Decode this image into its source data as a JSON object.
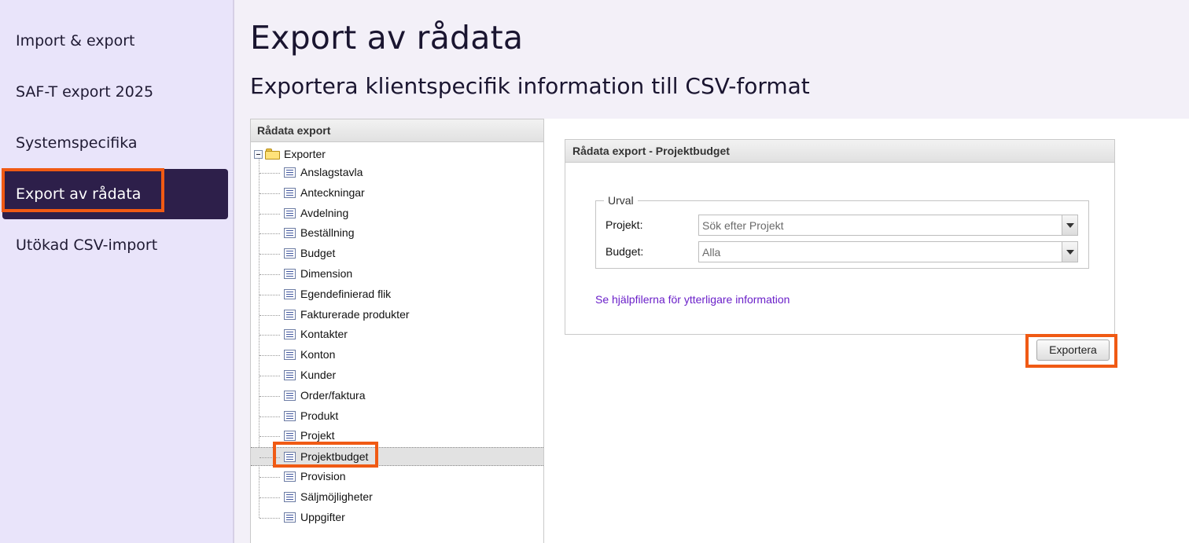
{
  "left_nav": {
    "items": [
      {
        "label": "Import & export",
        "active": false
      },
      {
        "label": "SAF-T export 2025",
        "active": false
      },
      {
        "label": "Systemspecifika",
        "active": false
      },
      {
        "label": "Export av rådata",
        "active": true
      },
      {
        "label": "Utökad CSV-import",
        "active": false
      }
    ]
  },
  "header": {
    "title": "Export av rådata",
    "subtitle": "Exportera klientspecifik information till CSV-format"
  },
  "tree": {
    "header": "Rådata export",
    "root_label": "Exporter",
    "root_icon": "folder-icon",
    "items": [
      "Anslagstavla",
      "Anteckningar",
      "Avdelning",
      "Beställning",
      "Budget",
      "Dimension",
      "Egendefinierad flik",
      "Fakturerade produkter",
      "Kontakter",
      "Konton",
      "Kunder",
      "Order/faktura",
      "Produkt",
      "Projekt",
      "Projektbudget",
      "Provision",
      "Säljmöjligheter",
      "Uppgifter"
    ],
    "selected": "Projektbudget"
  },
  "panel": {
    "header": "Rådata export - Projektbudget",
    "fieldset_legend": "Urval",
    "fields": [
      {
        "label": "Projekt:",
        "value": "Sök efter Projekt"
      },
      {
        "label": "Budget:",
        "value": "Alla"
      }
    ],
    "help_link": "Se hjälpfilerna för ytterligare information"
  },
  "actions": {
    "export_label": "Exportera"
  },
  "colors": {
    "nav_bg": "#e9e4fa",
    "nav_active_bg": "#2d1f4a",
    "highlight": "#f05a14",
    "link": "#6a1fc9"
  }
}
